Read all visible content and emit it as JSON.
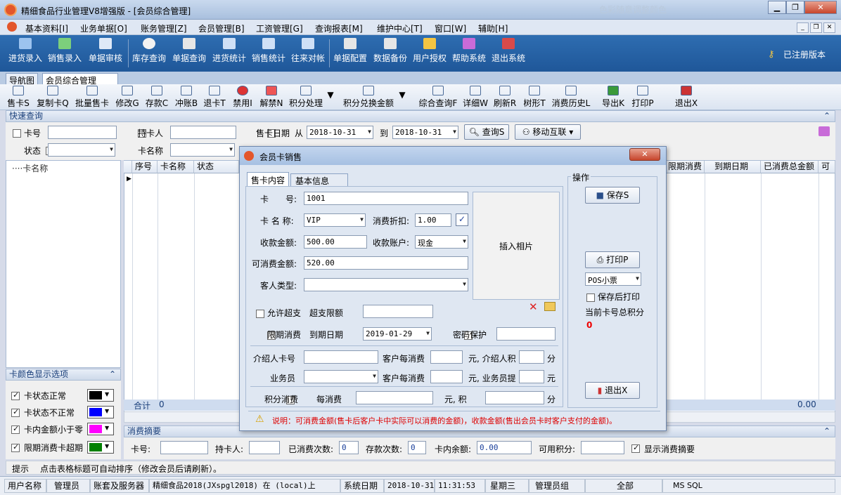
{
  "window": {
    "title": "精细食品行业管理V8增强版 - [会员综合管理]",
    "watermark": "色彩随意调整颜色"
  },
  "menu": [
    "基本资料[I]",
    "业务单据[O]",
    "账务管理[Z]",
    "会员管理[B]",
    "工资管理[G]",
    "查询报表[M]",
    "维护中心[T]",
    "窗口[W]",
    "辅助[H]"
  ],
  "toolbar": {
    "items": [
      "进货录入",
      "销售录入",
      "单据审核",
      "库存查询",
      "单据查询",
      "进货统计",
      "销售统计",
      "往来对帐",
      "单据配置",
      "数据备份",
      "用户授权",
      "帮助系统",
      "退出系统"
    ],
    "registered": "已注册版本"
  },
  "tabs": [
    "导航图",
    "会员综合管理"
  ],
  "toolbar2": [
    "售卡S",
    "复制卡Q",
    "批量售卡",
    "修改G",
    "存款C",
    "冲账B",
    "退卡T",
    "禁用I",
    "解禁N",
    "积分处理",
    "积分兑换金额",
    "综合查询F",
    "详细W",
    "刷新R",
    "树形T",
    "消费历史L",
    "导出K",
    "打印P",
    "退出X"
  ],
  "quick": {
    "title": "快速查询",
    "card_no": "卡号",
    "holder": "持卡人",
    "sale_date": "售卡日期",
    "from": "从",
    "date_from": "2018-10-31",
    "to": "到",
    "date_to": "2018-10-31",
    "query": "查询S",
    "mobile": "移动互联",
    "status": "状态",
    "card_name": "卡名称"
  },
  "tree": {
    "root": "卡名称"
  },
  "grid": {
    "headers_left": [
      "序号",
      "卡名称",
      "状态"
    ],
    "headers_right": [
      "限期消费",
      "到期日期",
      "已消费总金额",
      "可"
    ],
    "total_label": "合计",
    "total_val": "0",
    "total_amount": "0.00"
  },
  "color_opts": {
    "title": "卡颜色显示选项",
    "items": [
      {
        "label": "卡状态正常",
        "color": "#000000"
      },
      {
        "label": "卡状态不正常",
        "color": "#0000ff"
      },
      {
        "label": "卡内金额小于零",
        "color": "#ff00ff"
      },
      {
        "label": "限期消费卡超期",
        "color": "#008000"
      }
    ]
  },
  "summary": {
    "title": "消费摘要",
    "card_no": "卡号:",
    "holder": "持卡人:",
    "times": "已消费次数:",
    "times_v": "0",
    "deposits": "存款次数:",
    "deposits_v": "0",
    "balance": "卡内余额:",
    "balance_v": "0.00",
    "points": "可用积分:",
    "show": "显示消费摘要"
  },
  "hint": {
    "label": "提示",
    "text": "点击表格标题可自动排序（修改会员后请刷新）。"
  },
  "status": {
    "user_label": "用户名称",
    "user": "管理员",
    "account_label": "账套及服务器",
    "account": "精细食品2018(JXspgl2018) 在 (local)上",
    "date_label": "系统日期",
    "date": "2018-10-31",
    "time": "11:31:53",
    "weekday": "星期三",
    "group": "管理员组",
    "scope": "全部",
    "db": "MS SQL"
  },
  "dialog": {
    "title": "会员卡销售",
    "tab1": "售卡内容",
    "tab2": "基本信息",
    "card_no_l": "卡　　号:",
    "card_no": "1001",
    "card_name_l": "卡 名 称:",
    "card_name": "VIP",
    "discount_l": "消费折扣:",
    "discount": "1.00",
    "amount_l": "收款金额:",
    "amount": "500.00",
    "account_l": "收款账户:",
    "account": "现金",
    "spendable_l": "可消费金额:",
    "spendable": "520.00",
    "cust_type_l": "客人类型:",
    "photo": "插入相片",
    "overdraft": "允许超支",
    "overdraft_limit": "超支限额",
    "limited": "限期消费",
    "expire_l": "到期日期",
    "expire": "2019-01-29",
    "pwd": "密码保护",
    "referrer_l": "介绍人卡号",
    "per_spend1": "客户每消费",
    "unit_ref": "元, 介绍人积",
    "fen": "分",
    "salesman_l": "业务员",
    "per_spend2": "客户每消费",
    "unit_sales": "元, 业务员提",
    "yuan": "元",
    "points_l": "积分消费",
    "per_spend3": "每消费",
    "unit_pts": "元, 积",
    "fen2": "分",
    "ops": "操作",
    "save": "保存S",
    "print": "打印P",
    "print_type": "POS小票",
    "print_after": "保存后打印",
    "points_label": "当前卡号总积分",
    "points_val": "0",
    "exit": "退出X",
    "note": "说明：可消费金额(售卡后客户卡中实际可以消费的金额)，收款金额(售出会员卡时客户支付的金额)。"
  }
}
